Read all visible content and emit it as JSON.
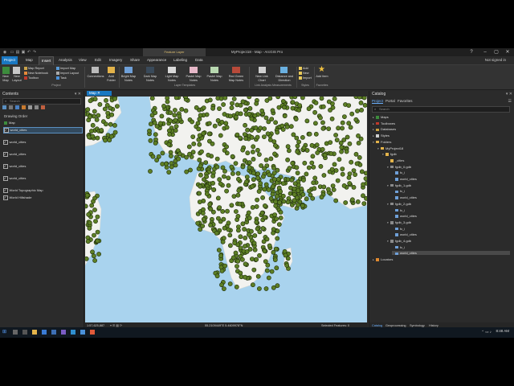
{
  "window": {
    "title": "MyProject18 - Map - ArcGIS Pro",
    "context_tab": "Feature Layer",
    "sign_in": "Not signed in"
  },
  "ribbon_tabs": [
    "Project",
    "Map",
    "Insert",
    "Analysis",
    "View",
    "Edit",
    "Imagery",
    "Share",
    "Appearance",
    "Labeling",
    "Data"
  ],
  "ribbon": {
    "project_group": {
      "new_map": "New Map",
      "new_layout": "New Layout",
      "map_report": "Map Report",
      "new_notebook": "New Notebook",
      "toolbox": "Toolbox",
      "import_map": "Import Map",
      "import_layout": "Import Layout",
      "task": "Task",
      "label": "Project"
    },
    "connections": "Connections",
    "add_folder": "Add Folder",
    "layer_templates": {
      "items": [
        "Bright Map Notes",
        "Dark Map Notes",
        "Light Map Notes",
        "Pastel Map Notes",
        "Pastel Map Notes",
        "Red Green Map Notes"
      ],
      "label": "Layer Templates"
    },
    "link_group": {
      "new_link_chart": "New Link Chart",
      "distance_direction": "Distance and Direction",
      "label": "Link Analysis Measurements"
    },
    "styles_group": {
      "add": "Add",
      "new": "New",
      "import": "Import",
      "label": "Styles"
    },
    "favorites_group": {
      "add_item": "Add Item",
      "label": "Favorites"
    }
  },
  "contents": {
    "title": "Contents",
    "search_placeholder": "Search",
    "drawing_order": "Drawing Order",
    "map_label": "Map",
    "layers": [
      "world_cities",
      "world_cities",
      "world_cities",
      "world_cities",
      "world_cities"
    ],
    "basemaps": [
      "World Topographic Map",
      "World Hillshade"
    ]
  },
  "map": {
    "tab_label": "Map",
    "scale": "1:57,625,887",
    "coordinates": "55.2109449°E 5.4609978°N",
    "selected": "Selected Features: 0",
    "colors": {
      "ocean": "#a9d3ee",
      "land": "#f2f2ef",
      "points": "#5d7f25"
    }
  },
  "catalog": {
    "title": "Catalog",
    "tabs": [
      "Project",
      "Portal",
      "Favorites"
    ],
    "search_placeholder": "Search",
    "tree": [
      {
        "label": "Maps",
        "level": 0,
        "type": "folder-map"
      },
      {
        "label": "Toolboxes",
        "level": 0,
        "type": "toolbox"
      },
      {
        "label": "Databases",
        "level": 0,
        "type": "db"
      },
      {
        "label": "Styles",
        "level": 0,
        "type": "style"
      },
      {
        "label": "Folders",
        "level": 0,
        "type": "folder"
      },
      {
        "label": "MyProject18",
        "level": 1,
        "type": "folder"
      },
      {
        "label": "fgdb",
        "level": 2,
        "type": "folder"
      },
      {
        "label": "_cities",
        "level": 3,
        "type": "folder"
      },
      {
        "label": "fgdb_0.gdb",
        "level": 3,
        "type": "gdb"
      },
      {
        "label": "fc_i",
        "level": 4,
        "type": "fc"
      },
      {
        "label": "world_cities",
        "level": 4,
        "type": "fc"
      },
      {
        "label": "fgdb_1.gdb",
        "level": 3,
        "type": "gdb"
      },
      {
        "label": "fc_i",
        "level": 4,
        "type": "fc"
      },
      {
        "label": "world_cities",
        "level": 4,
        "type": "fc"
      },
      {
        "label": "fgdb_2.gdb",
        "level": 3,
        "type": "gdb"
      },
      {
        "label": "fc_i",
        "level": 4,
        "type": "fc"
      },
      {
        "label": "world_cities",
        "level": 4,
        "type": "fc"
      },
      {
        "label": "fgdb_3.gdb",
        "level": 3,
        "type": "gdb"
      },
      {
        "label": "fc_i",
        "level": 4,
        "type": "fc"
      },
      {
        "label": "world_cities",
        "level": 4,
        "type": "fc"
      },
      {
        "label": "fgdb_4.gdb",
        "level": 3,
        "type": "gdb"
      },
      {
        "label": "fc_i",
        "level": 4,
        "type": "fc"
      },
      {
        "label": "world_cities",
        "level": 4,
        "type": "fc"
      },
      {
        "label": "Locators",
        "level": 0,
        "type": "locator"
      }
    ],
    "bottom_tabs": [
      "Catalog",
      "Geoprocessing",
      "Symbology",
      "History"
    ]
  },
  "taskbar": {
    "time": "8:48 AM"
  }
}
